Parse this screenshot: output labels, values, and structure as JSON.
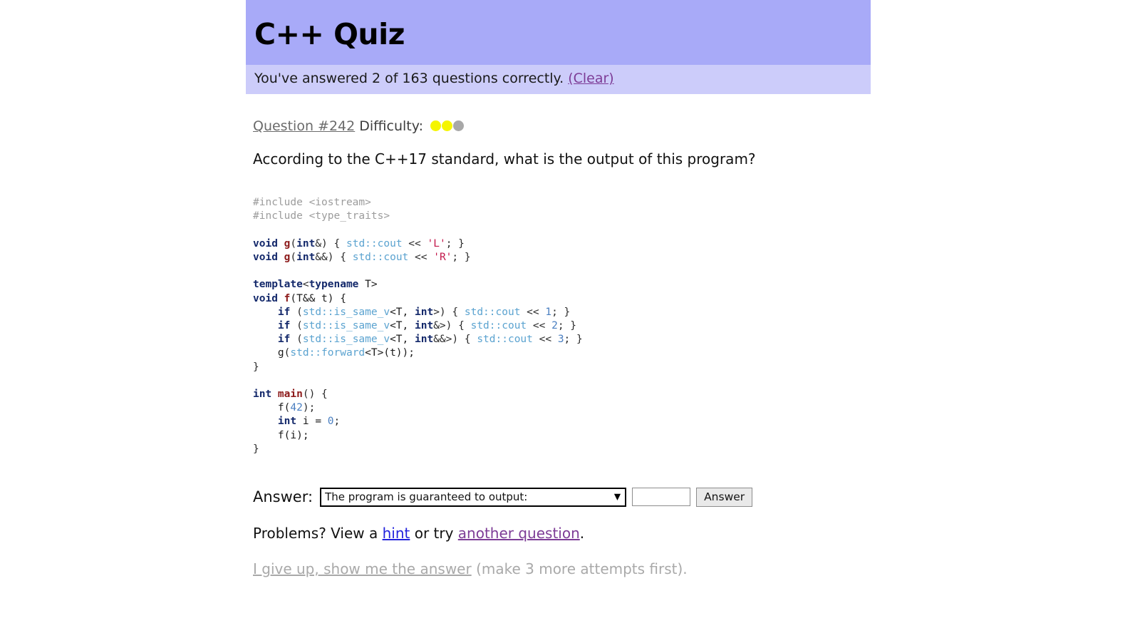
{
  "header": {
    "title": "C++ Quiz",
    "progress_prefix": "You've answered 2 of 163 questions correctly.",
    "clear_label": "(Clear)",
    "banner_color": "#a8aaf8",
    "subbanner_color": "#ccccfa"
  },
  "question": {
    "number_label": "Question #242",
    "difficulty_label": "Difficulty:",
    "difficulty_filled": 2,
    "difficulty_total": 3,
    "difficulty_on_color": "#f5f500",
    "difficulty_off_color": "#a8a8a8",
    "prompt": "According to the C++17 standard, what is the output of this program?"
  },
  "code": {
    "language": "cpp",
    "lines": [
      [
        {
          "t": "#include <iostream>",
          "c": "c-pre"
        }
      ],
      [
        {
          "t": "#include <type_traits>",
          "c": "c-pre"
        }
      ],
      [],
      [
        {
          "t": "void ",
          "c": "c-kw"
        },
        {
          "t": "g",
          "c": "c-fn"
        },
        {
          "t": "(",
          "c": "c-pun"
        },
        {
          "t": "int",
          "c": "c-kw"
        },
        {
          "t": "&) { ",
          "c": "c-pun"
        },
        {
          "t": "std::cout",
          "c": "c-id"
        },
        {
          "t": " << ",
          "c": "c-pun"
        },
        {
          "t": "'L'",
          "c": "c-str"
        },
        {
          "t": "; }",
          "c": "c-pun"
        }
      ],
      [
        {
          "t": "void ",
          "c": "c-kw"
        },
        {
          "t": "g",
          "c": "c-fn"
        },
        {
          "t": "(",
          "c": "c-pun"
        },
        {
          "t": "int",
          "c": "c-kw"
        },
        {
          "t": "&&) { ",
          "c": "c-pun"
        },
        {
          "t": "std::cout",
          "c": "c-id"
        },
        {
          "t": " << ",
          "c": "c-pun"
        },
        {
          "t": "'R'",
          "c": "c-str"
        },
        {
          "t": "; }",
          "c": "c-pun"
        }
      ],
      [],
      [
        {
          "t": "template",
          "c": "c-kw"
        },
        {
          "t": "<",
          "c": "c-pun"
        },
        {
          "t": "typename",
          "c": "c-kw"
        },
        {
          "t": " T>",
          "c": "c-plain"
        }
      ],
      [
        {
          "t": "void ",
          "c": "c-kw"
        },
        {
          "t": "f",
          "c": "c-fn"
        },
        {
          "t": "(T&& t) {",
          "c": "c-plain"
        }
      ],
      [
        {
          "t": "    ",
          "c": "c-plain"
        },
        {
          "t": "if",
          "c": "c-kw"
        },
        {
          "t": " (",
          "c": "c-pun"
        },
        {
          "t": "std::is_same_v",
          "c": "c-id"
        },
        {
          "t": "<T, ",
          "c": "c-plain"
        },
        {
          "t": "int",
          "c": "c-kw"
        },
        {
          "t": ">) { ",
          "c": "c-pun"
        },
        {
          "t": "std::cout",
          "c": "c-id"
        },
        {
          "t": " << ",
          "c": "c-pun"
        },
        {
          "t": "1",
          "c": "c-num"
        },
        {
          "t": "; }",
          "c": "c-pun"
        }
      ],
      [
        {
          "t": "    ",
          "c": "c-plain"
        },
        {
          "t": "if",
          "c": "c-kw"
        },
        {
          "t": " (",
          "c": "c-pun"
        },
        {
          "t": "std::is_same_v",
          "c": "c-id"
        },
        {
          "t": "<T, ",
          "c": "c-plain"
        },
        {
          "t": "int",
          "c": "c-kw"
        },
        {
          "t": "&>) { ",
          "c": "c-pun"
        },
        {
          "t": "std::cout",
          "c": "c-id"
        },
        {
          "t": " << ",
          "c": "c-pun"
        },
        {
          "t": "2",
          "c": "c-num"
        },
        {
          "t": "; }",
          "c": "c-pun"
        }
      ],
      [
        {
          "t": "    ",
          "c": "c-plain"
        },
        {
          "t": "if",
          "c": "c-kw"
        },
        {
          "t": " (",
          "c": "c-pun"
        },
        {
          "t": "std::is_same_v",
          "c": "c-id"
        },
        {
          "t": "<T, ",
          "c": "c-plain"
        },
        {
          "t": "int",
          "c": "c-kw"
        },
        {
          "t": "&&>) { ",
          "c": "c-pun"
        },
        {
          "t": "std::cout",
          "c": "c-id"
        },
        {
          "t": " << ",
          "c": "c-pun"
        },
        {
          "t": "3",
          "c": "c-num"
        },
        {
          "t": "; }",
          "c": "c-pun"
        }
      ],
      [
        {
          "t": "    ",
          "c": "c-plain"
        },
        {
          "t": "g",
          "c": "c-plain"
        },
        {
          "t": "(",
          "c": "c-pun"
        },
        {
          "t": "std::forward",
          "c": "c-id"
        },
        {
          "t": "<T>(t));",
          "c": "c-plain"
        }
      ],
      [
        {
          "t": "}",
          "c": "c-pun"
        }
      ],
      [],
      [
        {
          "t": "int ",
          "c": "c-kw"
        },
        {
          "t": "main",
          "c": "c-fn"
        },
        {
          "t": "() {",
          "c": "c-pun"
        }
      ],
      [
        {
          "t": "    f(",
          "c": "c-plain"
        },
        {
          "t": "42",
          "c": "c-num"
        },
        {
          "t": ");",
          "c": "c-pun"
        }
      ],
      [
        {
          "t": "    ",
          "c": "c-plain"
        },
        {
          "t": "int",
          "c": "c-kw"
        },
        {
          "t": " i = ",
          "c": "c-plain"
        },
        {
          "t": "0",
          "c": "c-num"
        },
        {
          "t": ";",
          "c": "c-pun"
        }
      ],
      [
        {
          "t": "    f(i);",
          "c": "c-plain"
        }
      ],
      [
        {
          "t": "}",
          "c": "c-pun"
        }
      ]
    ]
  },
  "answer": {
    "label": "Answer:",
    "select_value": "The program is guaranteed to output:",
    "select_options": [
      "The program is guaranteed to output:"
    ],
    "input_value": "",
    "input_placeholder": "",
    "button_label": "Answer",
    "chevron": "▼"
  },
  "footer": {
    "problems_prefix": "Problems? View a",
    "hint_label": "hint",
    "problems_middle": "or try",
    "another_question_label": "another question",
    "problems_suffix": ".",
    "giveup_link": "I give up, show me the answer",
    "giveup_suffix": "(make 3 more attempts first)."
  }
}
